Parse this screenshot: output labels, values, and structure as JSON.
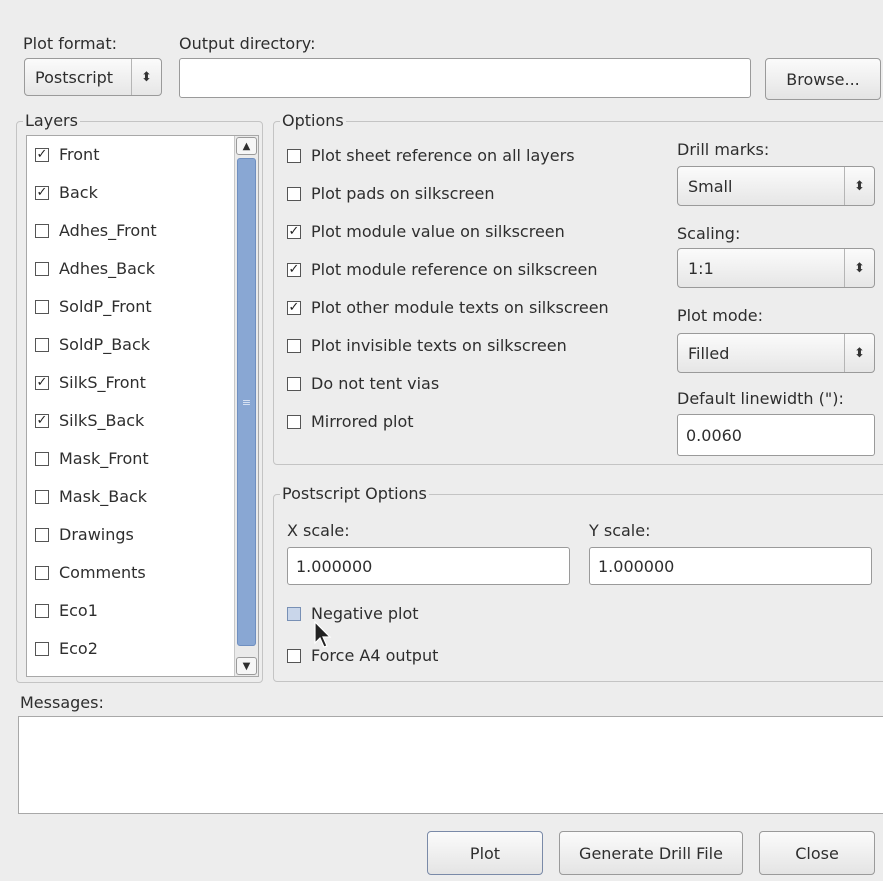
{
  "top": {
    "plot_format_label": "Plot format:",
    "plot_format_value": "Postscript",
    "output_dir_label": "Output directory:",
    "output_dir_value": "",
    "browse_label": "Browse..."
  },
  "layers": {
    "title": "Layers",
    "items": [
      {
        "label": "Front",
        "checked": true
      },
      {
        "label": "Back",
        "checked": true
      },
      {
        "label": "Adhes_Front",
        "checked": false
      },
      {
        "label": "Adhes_Back",
        "checked": false
      },
      {
        "label": "SoldP_Front",
        "checked": false
      },
      {
        "label": "SoldP_Back",
        "checked": false
      },
      {
        "label": "SilkS_Front",
        "checked": true
      },
      {
        "label": "SilkS_Back",
        "checked": true
      },
      {
        "label": "Mask_Front",
        "checked": false
      },
      {
        "label": "Mask_Back",
        "checked": false
      },
      {
        "label": "Drawings",
        "checked": false
      },
      {
        "label": "Comments",
        "checked": false
      },
      {
        "label": "Eco1",
        "checked": false
      },
      {
        "label": "Eco2",
        "checked": false
      }
    ]
  },
  "options": {
    "title": "Options",
    "items": [
      {
        "label": "Plot sheet reference on all layers",
        "checked": false
      },
      {
        "label": "Plot pads on silkscreen",
        "checked": false
      },
      {
        "label": "Plot module value on silkscreen",
        "checked": true
      },
      {
        "label": "Plot module reference on silkscreen",
        "checked": true
      },
      {
        "label": "Plot other module texts on silkscreen",
        "checked": true
      },
      {
        "label": "Plot invisible texts on silkscreen",
        "checked": false
      },
      {
        "label": "Do not tent vias",
        "checked": false
      },
      {
        "label": "Mirrored plot",
        "checked": false
      }
    ],
    "drill_marks_label": "Drill marks:",
    "drill_marks_value": "Small",
    "scaling_label": "Scaling:",
    "scaling_value": "1:1",
    "plot_mode_label": "Plot mode:",
    "plot_mode_value": "Filled",
    "linewidth_label": "Default linewidth (\"):",
    "linewidth_value": "0.0060"
  },
  "postscript": {
    "title": "Postscript Options",
    "x_scale_label": "X scale:",
    "x_scale_value": "1.000000",
    "y_scale_label": "Y scale:",
    "y_scale_value": "1.000000",
    "negative_plot_label": "Negative plot",
    "negative_plot_checked": false,
    "force_a4_label": "Force A4 output",
    "force_a4_checked": false
  },
  "messages": {
    "title": "Messages:",
    "content": ""
  },
  "buttons": {
    "plot": "Plot",
    "drill": "Generate Drill File",
    "close": "Close"
  },
  "icons": {
    "check": "✓",
    "updown": "⌃⌄",
    "scroll_up": "▲",
    "scroll_down": "▼",
    "thumb_grip": "≡"
  }
}
